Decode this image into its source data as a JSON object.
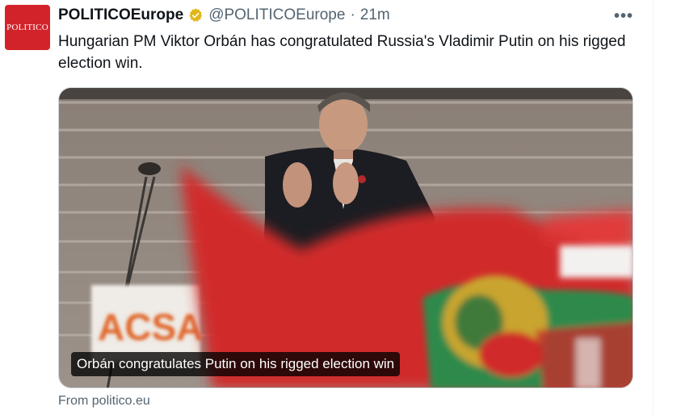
{
  "author": {
    "display_name": "POLITICOEurope",
    "handle": "@POLITICOEurope",
    "separator": "·",
    "time": "21m",
    "avatar_text": "POLITICO",
    "avatar_color": "#d2232a",
    "verified_icon": "verified-badge-icon"
  },
  "tweet": {
    "text": "Hungarian PM Viktor Orbán has congratulated Russia's Vladimir Putin on his rigged election win."
  },
  "card": {
    "caption": "Orbán congratulates Putin on his rigged election win",
    "sign_text": "ACSA",
    "source": "From politico.eu"
  },
  "menu": {
    "more_label": "•••"
  }
}
